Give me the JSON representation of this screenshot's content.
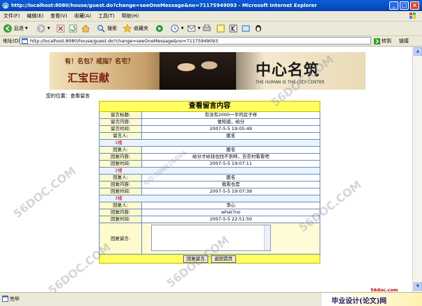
{
  "window": {
    "title": "http://localhost:8080/house/guest.do?change=seeOneMessage&no=71175949093 - Microsoft Internet Explorer",
    "minimize": "_",
    "maximize": "□",
    "close": "×"
  },
  "menu": [
    "文件(F)",
    "编辑(E)",
    "查看(V)",
    "收藏(A)",
    "工具(T)",
    "帮助(H)"
  ],
  "toolbar": {
    "back": "后退",
    "search": "搜索",
    "favorites": "收藏夹"
  },
  "address": {
    "label": "地址(D)",
    "url": "http://localhost:8080/house/guest.do?change=seeOneMessage&no=71175949093",
    "go": "转到",
    "links": "链接"
  },
  "banner": {
    "slogan": "有！名包？戒指？名宅？",
    "brand_left": "汇宝巨献",
    "brand_right": "中心名筑",
    "brand_right_sub": "THE HUMAN IS THE CITY CENTER"
  },
  "location": "您的位置：查看留言",
  "message": {
    "header": "查看留言内容",
    "fields": [
      {
        "label": "留言标题:",
        "value": "有没有2000一平的房子呀"
      },
      {
        "label": "留言内容:",
        "value": "谁知道，给分"
      },
      {
        "label": "留言时间:",
        "value": "2007-5-5 19:05:49"
      },
      {
        "label": "留言人:",
        "value": "匿名"
      }
    ],
    "replies": [
      {
        "floor": "1楼",
        "person_label": "回复人:",
        "person": "匿名",
        "content_label": "回复内容:",
        "content": "给分才给钱也找不到呀，去农村看看吧",
        "time_label": "回复时间:",
        "time": "2007-5-5 19:07:11"
      },
      {
        "floor": "2楼",
        "person_label": "回复人:",
        "person": "匿名",
        "content_label": "回复内容:",
        "content": "我看也是",
        "time_label": "回复时间:",
        "time": "2007-5-5 19:07:39"
      },
      {
        "floor": "3楼",
        "person_label": "回复人:",
        "person": "李心",
        "content_label": "回复内容:",
        "content": "what?no",
        "time_label": "回复时间:",
        "time": "2007-5-5 22:51:50"
      }
    ],
    "reply_label": "回复留言:",
    "reply_value": "",
    "submit_button": "回复留言",
    "home_button": "返回首页"
  },
  "watermarks": [
    "56DOC.COM",
    "56DOC.COM",
    "56DOC.COM",
    "56DOC.COM",
    "56DOC.COM",
    "QQ:306826066"
  ],
  "status": {
    "text": "完毕",
    "site_url": "56doc.com",
    "site_name": "毕业设计(论文)网"
  },
  "colors": {
    "title_bar": "#0a5fd8",
    "table_header": "#ffff60",
    "label_cell": "#fdfacd",
    "floor_text": "#c00000"
  }
}
